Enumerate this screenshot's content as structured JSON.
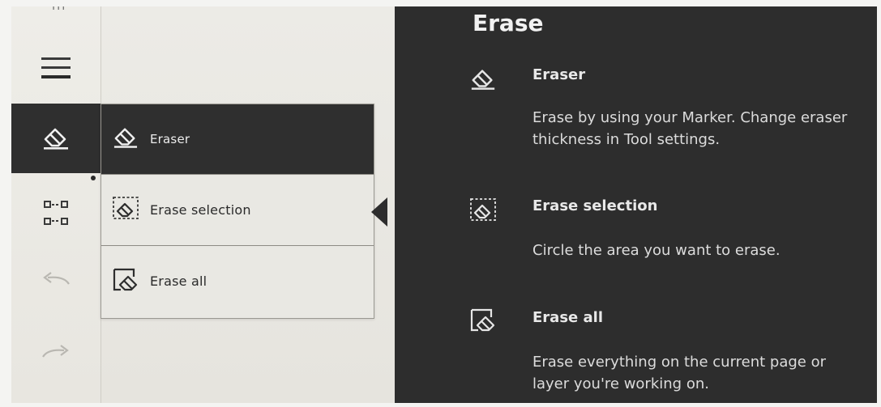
{
  "toolbar": {
    "top_fragment": "III",
    "items": [
      {
        "icon": "hamburger-menu-icon"
      },
      {
        "icon": "eraser-icon",
        "active": true
      },
      {
        "icon": "selection-icon",
        "has_badge": true
      },
      {
        "icon": "undo-icon"
      },
      {
        "icon": "redo-icon"
      }
    ]
  },
  "submenu": {
    "items": [
      {
        "label": "Eraser",
        "icon": "eraser-icon",
        "active": true
      },
      {
        "label": "Erase selection",
        "icon": "erase-selection-icon"
      },
      {
        "label": "Erase all",
        "icon": "erase-all-icon"
      }
    ]
  },
  "help_panel": {
    "title": "Erase",
    "sections": [
      {
        "icon": "eraser-icon",
        "heading": "Eraser",
        "description": "Erase by using your Marker. Change eraser thickness in Tool settings."
      },
      {
        "icon": "erase-selection-icon",
        "heading": "Erase selection",
        "description": "Circle the area you want to erase."
      },
      {
        "icon": "erase-all-icon",
        "heading": "Erase all",
        "description": "Erase everything on the current page or layer you're working on."
      }
    ]
  },
  "colors": {
    "panel_background": "#2d2d2d",
    "active_item": "#2f2f2f",
    "screen_background": "#ecebe6"
  }
}
